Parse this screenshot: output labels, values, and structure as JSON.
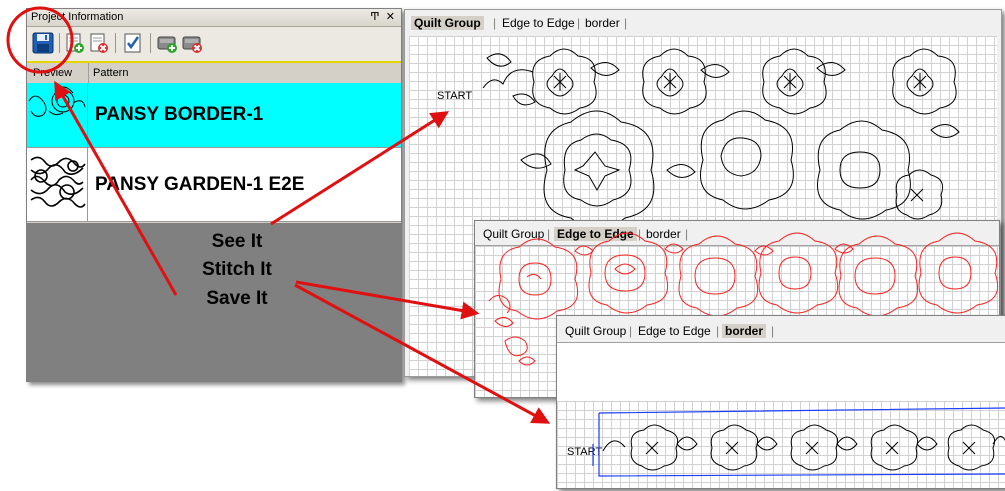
{
  "panel": {
    "title": "Project Information",
    "pin_glyph": "Ͳ",
    "close_glyph": "✕",
    "columns": {
      "preview": "Preview",
      "pattern": "Pattern"
    },
    "rows": [
      {
        "name": "PANSY BORDER-1",
        "color": "#00ffff"
      },
      {
        "name": "PANSY GARDEN-1 E2E",
        "color": "#ffffff"
      }
    ],
    "toolbar_icons": [
      "save-icon",
      "add-pattern-icon",
      "remove-pattern-icon",
      "checklist-icon",
      "add-group-icon",
      "remove-group-icon"
    ]
  },
  "slogan": {
    "line1": "See It",
    "line2": "Stitch It",
    "line3": "Save It"
  },
  "window1": {
    "tabs": [
      "Quilt Group",
      "Edge to Edge",
      "border"
    ],
    "active": "Quilt Group",
    "start_label": "START"
  },
  "window2": {
    "tabs": [
      "Quilt Group",
      "Edge to Edge",
      "border"
    ],
    "active": "Edge to Edge"
  },
  "window3": {
    "tabs": [
      "Quilt Group",
      "Edge to Edge",
      "border"
    ],
    "active": "border",
    "start_label": "START"
  },
  "colors": {
    "arrow": "#e01010",
    "highlight_row": "#00ffff",
    "border_pattern": "#1a3cff",
    "e2e_pattern": "#ff2020"
  }
}
